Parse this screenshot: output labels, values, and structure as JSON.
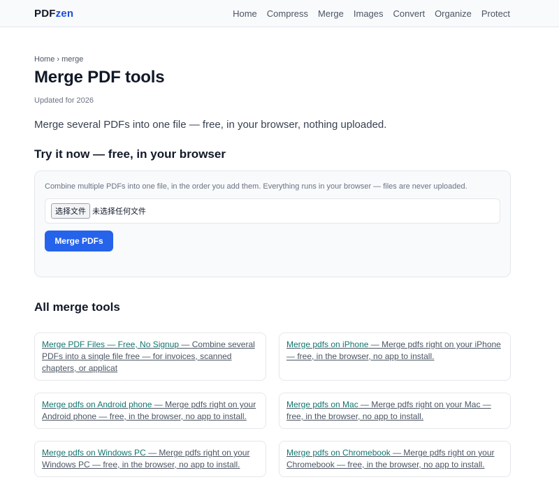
{
  "header": {
    "logo_part1": "PDF",
    "logo_part2": "zen",
    "nav": [
      "Home",
      "Compress",
      "Merge",
      "Images",
      "Convert",
      "Organize",
      "Protect"
    ]
  },
  "breadcrumb": {
    "home": "Home",
    "separator": "›",
    "current": "merge"
  },
  "page": {
    "title": "Merge PDF tools",
    "updated": "Updated for 2026",
    "intro": "Merge several PDFs into one file — free, in your browser, nothing uploaded."
  },
  "tool": {
    "section_title": "Try it now — free, in your browser",
    "description": "Combine multiple PDFs into one file, in the order you add them. Everything runs in your browser — files are never uploaded.",
    "file_button": "选择文件",
    "file_status": "未选择任何文件",
    "merge_button": "Merge PDFs"
  },
  "all_tools": {
    "section_title": "All merge tools",
    "cards": [
      {
        "title": "Merge PDF Files — Free, No Signup",
        "desc": " — Combine several PDFs into a single file free — for invoices, scanned chapters, or applicat"
      },
      {
        "title": "Merge pdfs on iPhone",
        "desc": " — Merge pdfs right on your iPhone — free, in the browser, no app to install."
      },
      {
        "title": "Merge pdfs on Android phone",
        "desc": " — Merge pdfs right on your Android phone — free, in the browser, no app to install."
      },
      {
        "title": "Merge pdfs on Mac",
        "desc": " — Merge pdfs right on your Mac — free, in the browser, no app to install."
      },
      {
        "title": "Merge pdfs on Windows PC",
        "desc": " — Merge pdfs right on your Windows PC — free, in the browser, no app to install."
      },
      {
        "title": "Merge pdfs on Chromebook",
        "desc": " — Merge pdfs right on your Chromebook — free, in the browser, no app to install."
      }
    ]
  },
  "colors": {
    "accent": "#2563eb",
    "link": "#0f766e",
    "logo_accent": "#1d4ed8"
  }
}
